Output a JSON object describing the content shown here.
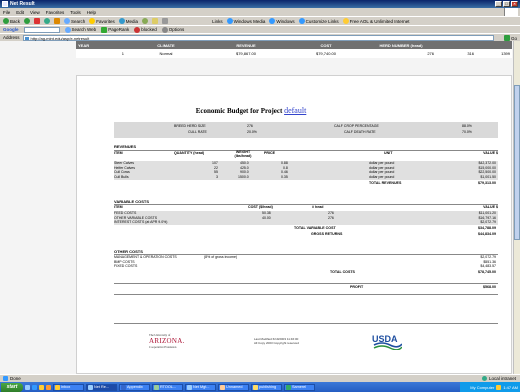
{
  "window": {
    "title": "Net Result"
  },
  "menubar": {
    "items": [
      "File",
      "Edit",
      "View",
      "Favorites",
      "Tools",
      "Help"
    ]
  },
  "toolbar": {
    "back": "Back",
    "search": "Search",
    "favorites": "Favorites",
    "media": "Media",
    "links_label": "Links",
    "links": [
      "Windows Media",
      "Windows",
      "Customize Links",
      "Free AOL & Unlimited Internet"
    ]
  },
  "toolbar2": {
    "google": "Google",
    "search_web": "Search Web",
    "pagerank": "PageRank",
    "blocked": "blocked",
    "options": "Options"
  },
  "address": {
    "label": "Address",
    "value": "http://ag-mint.edu/asp/e-netresult",
    "go": "Go"
  },
  "summary": {
    "headers": [
      "YEAR",
      "CLIMATE",
      "REVENUE",
      "COST",
      "HERD NUMBER (head)",
      "",
      ""
    ],
    "row": [
      "1",
      "Normal",
      "$79,867.00",
      "$79,740.00",
      "276",
      "316",
      "1399"
    ]
  },
  "budget": {
    "title": "Economic Budget for Project",
    "project": "default"
  },
  "info": {
    "left_labels": [
      "BREED HERD SIZE",
      "CULL RATE"
    ],
    "left_values": [
      "276",
      "20.0%"
    ],
    "right_labels": [
      "CALF CROP PERCENTAGE",
      "CALF DEATH RATE"
    ],
    "right_values": [
      "88.0%",
      "70.0%"
    ]
  },
  "revenues": {
    "title": "REVENUES",
    "headers": [
      "ITEM",
      "QUANTITY (head)",
      "WEIGHT (lbs/head)",
      "PRICE",
      "UNIT",
      "VALUE $"
    ],
    "rows": [
      {
        "item": "Steer Calves",
        "qty": "107",
        "weight": "450.0",
        "price": "0.88",
        "unit": "dollar per pound",
        "value": "$42,372.00"
      },
      {
        "item": "Heifer Calves",
        "qty": "22",
        "weight": "425.0",
        "price": "0.8",
        "unit": "dollar per pound",
        "value": "$15,000.00"
      },
      {
        "item": "Cull Cows",
        "qty": "55",
        "weight": "900.0",
        "price": "0.46",
        "unit": "dollar per pound",
        "value": "$22,500.00"
      },
      {
        "item": "Cull Bulls",
        "qty": "3",
        "weight": "1500.0",
        "price": "0.35",
        "unit": "dollar per pound",
        "value": "$1,001.50"
      }
    ],
    "total_label": "TOTAL REVENUES",
    "total_value": "$79,313.00"
  },
  "variable": {
    "title": "VARIABLE COSTS",
    "headers": [
      "ITEM",
      "COST ($/head)",
      "# head",
      "VALUE $"
    ],
    "rows": [
      {
        "item": "FEED COSTS",
        "cost": "50.38",
        "head": "276",
        "value": "$11,001.20"
      },
      {
        "item": "OTHER VARIABLE COSTS",
        "cost": "40.00",
        "head": "276",
        "value": "$16,797.16"
      },
      {
        "item": "INTEREST COSTS (at APR 9.0%)",
        "cost": "",
        "head": "",
        "value": "$2,072.79"
      }
    ],
    "total_label": "TOTAL VARIABLE COST",
    "total_value": "$34,788.09",
    "gross_label": "GROSS RETURNS",
    "gross_value": "$44,834.09"
  },
  "other": {
    "title": "OTHER COSTS",
    "rows": [
      {
        "item": "MANAGEMENT & OPERATION COSTS",
        "note": "(8% of gross income)",
        "value": "$2,072.79"
      },
      {
        "item": "BMP COSTS",
        "note": "",
        "value": "$551.36"
      },
      {
        "item": "FIXED COSTS",
        "note": "",
        "value": "$4,483.57"
      }
    ],
    "total_label": "TOTAL COSTS",
    "total_value": "$78,745.00",
    "profit_label": "PROFIT",
    "profit_value": "$568.00"
  },
  "footer": {
    "az_small": "The University of",
    "az_name": "ARIZONA.",
    "az_sub": "Cooperative Extension",
    "text_line1": "Last Modified 6/19/2003 11:46:00",
    "text_line2": "All Copy 2003 Copyright reserved",
    "usda": "USDA"
  },
  "status": {
    "left": "Done",
    "right": "Local intranet"
  },
  "taskbar": {
    "start": "start",
    "tasks": [
      "Inbox",
      "Net Re...",
      "Appendix",
      "RTOOL...",
      "Net Mgt...",
      "Unnamed",
      "publishing",
      "Samerel"
    ],
    "tray_text": "My Computer",
    "clock": "1:47 AM"
  },
  "colors": {
    "title_bar": "#0a246a",
    "link": "#3344cc",
    "header_gray": "#707070",
    "block_gray": "#e0e0e0",
    "arizona": "#aa1133",
    "usda_blue": "#1f4fa0"
  }
}
